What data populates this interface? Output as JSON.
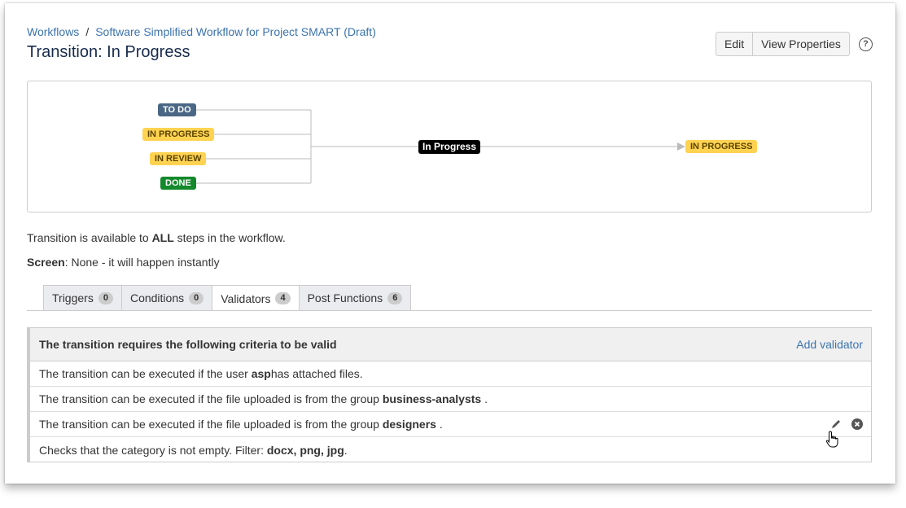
{
  "breadcrumb": {
    "workflows": "Workflows",
    "separator": "/",
    "workflow_name": "Software Simplified Workflow for Project SMART (Draft)"
  },
  "page_title": "Transition: In Progress",
  "actions": {
    "edit": "Edit",
    "view_properties": "View Properties",
    "help": "?"
  },
  "diagram": {
    "from_statuses": [
      {
        "label": "TO DO",
        "color": "#4a6785"
      },
      {
        "label": "IN PROGRESS",
        "color": "#ffd351"
      },
      {
        "label": "IN REVIEW",
        "color": "#ffd351"
      },
      {
        "label": "DONE",
        "color": "#14892c"
      }
    ],
    "transition": "In Progress",
    "to_status": {
      "label": "IN PROGRESS",
      "color": "#ffd351"
    }
  },
  "info": {
    "availability_prefix": "Transition is available to ",
    "availability_bold": "ALL",
    "availability_suffix": " steps in the workflow.",
    "screen_label": "Screen",
    "screen_value": ": None - it will happen instantly"
  },
  "tabs": [
    {
      "label": "Triggers",
      "count": "0"
    },
    {
      "label": "Conditions",
      "count": "0"
    },
    {
      "label": "Validators",
      "count": "4"
    },
    {
      "label": "Post Functions",
      "count": "6"
    }
  ],
  "panel": {
    "title": "The transition requires the following criteria to be valid",
    "add_link": "Add validator",
    "rows": [
      {
        "pre": "The transition can be executed if the user ",
        "bold": "asp",
        "post": " has attached files."
      },
      {
        "pre": "The transition can be executed if the file uploaded is from the group ",
        "bold": "business-analysts",
        "post": " ."
      },
      {
        "pre": "The transition can be executed if the file uploaded is from the group ",
        "bold": "designers",
        "post": " ."
      },
      {
        "pre": "Checks that the category is not empty. Filter: ",
        "bold": "docx, png, jpg",
        "post": "."
      }
    ]
  },
  "colors": {
    "link": "#3b73af",
    "lozenge_yellow": "#ffd351",
    "lozenge_blue": "#4a6785",
    "lozenge_green": "#14892c"
  }
}
